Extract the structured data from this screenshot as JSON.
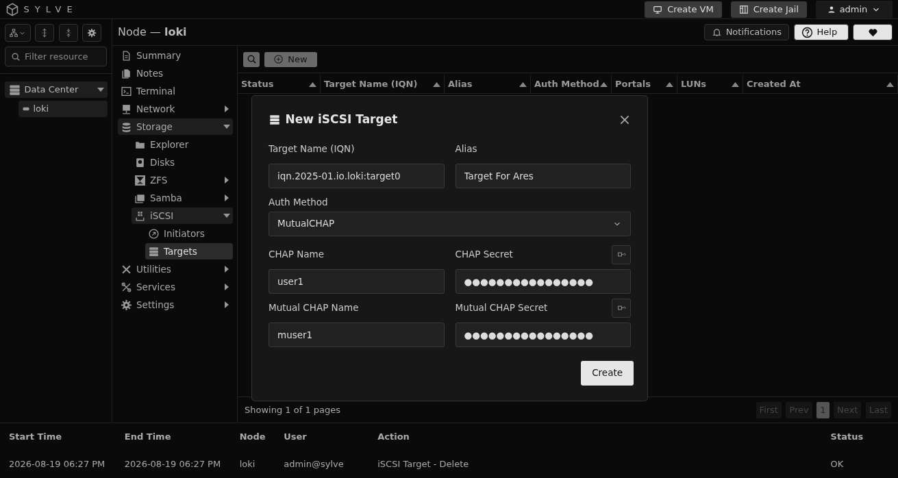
{
  "app": {
    "brand": "SYLVE"
  },
  "header_buttons": [
    {
      "label": "Create VM",
      "kind": "monitor"
    },
    {
      "label": "Create Jail",
      "kind": "jail"
    }
  ],
  "user_menu": {
    "label": "admin"
  },
  "page_title": "Node — **loki**",
  "top_actions": [
    {
      "label": "Notifications",
      "kind": "bell"
    },
    {
      "label": "Help",
      "kind": "help"
    },
    {
      "kind": "heart"
    }
  ],
  "resource_filter": {
    "placeholder": "Filter resource"
  },
  "tree": [
    {
      "label": "Data Center",
      "kind": "server",
      "expanded": true,
      "children": [
        {
          "label": "loki",
          "kind": "node"
        }
      ]
    }
  ],
  "nav": [
    {
      "label": "Summary",
      "kind": "doc",
      "selected": false
    },
    {
      "label": "Notes",
      "kind": "notes",
      "selected": false
    },
    {
      "label": "Terminal",
      "kind": "terminal",
      "selected": false
    },
    {
      "label": "Network",
      "kind": "network",
      "selected": false,
      "expanded": false
    },
    {
      "label": "Storage",
      "kind": "db",
      "selected": false,
      "expanded": true,
      "children": [
        {
          "label": "Explorer",
          "kind": "folder",
          "selected": false
        },
        {
          "label": "Disks",
          "kind": "disk",
          "selected": false
        },
        {
          "label": "ZFS",
          "kind": "zfs",
          "selected": false,
          "expanded": false
        },
        {
          "label": "Samba",
          "kind": "samba",
          "selected": false,
          "expanded": false
        },
        {
          "label": "iSCSI",
          "kind": "iscsi",
          "selected": false,
          "expanded": true,
          "children": [
            {
              "label": "Initiators",
              "kind": "initiator",
              "selected": false
            },
            {
              "label": "Targets",
              "kind": "server",
              "selected": true
            }
          ]
        }
      ]
    },
    {
      "label": "Utilities",
      "kind": "tools",
      "selected": false,
      "expanded": false
    },
    {
      "label": "Services",
      "kind": "services",
      "selected": false,
      "expanded": false
    },
    {
      "label": "Settings",
      "kind": "gear",
      "selected": false,
      "expanded": false
    }
  ],
  "toolbar": {
    "new_button": "New"
  },
  "table": {
    "columns": [
      "Status",
      "Target Name (IQN)",
      "Alias",
      "Auth Method",
      "Portals",
      "LUNs",
      "Created At"
    ],
    "summary": "Showing 1 of 1 pages",
    "pagination": [
      {
        "label": "First",
        "disabled": true,
        "selected": false
      },
      {
        "label": "Prev",
        "disabled": true,
        "selected": false
      },
      {
        "label": "1",
        "disabled": false,
        "selected": true
      },
      {
        "label": "Next",
        "disabled": true,
        "selected": false
      },
      {
        "label": "Last",
        "disabled": true,
        "selected": false
      }
    ]
  },
  "dialog": {
    "title": "New iSCSI Target",
    "fields": [
      {
        "label": "Target Name (IQN)",
        "value": "iqn.2025-01.io.loki:target0",
        "kind": "text"
      },
      {
        "label": "Alias",
        "value": "Target For Ares",
        "kind": "text"
      },
      {
        "label": "Auth Method",
        "value": "MutualCHAP",
        "kind": "select"
      },
      {
        "label": "CHAP Name",
        "value": "user1",
        "kind": "text"
      },
      {
        "label": "CHAP Secret",
        "value": "●●●●●●●●●●●●●●●●",
        "kind": "secret"
      },
      {
        "label": "Mutual CHAP Name",
        "value": "muser1",
        "kind": "text"
      },
      {
        "label": "Mutual CHAP Secret",
        "value": "●●●●●●●●●●●●●●●●",
        "kind": "secret"
      }
    ],
    "submit": "Create"
  },
  "activity_log": {
    "columns": [
      "Start Time",
      "End Time",
      "Node",
      "User",
      "Action",
      "Status"
    ],
    "rows": [
      {
        "cells": [
          "2026-08-19 06:27 PM",
          "2026-08-19 06:27 PM",
          "loki",
          "admin@sylve",
          "iSCSI Target - Delete",
          "OK"
        ]
      }
    ]
  }
}
